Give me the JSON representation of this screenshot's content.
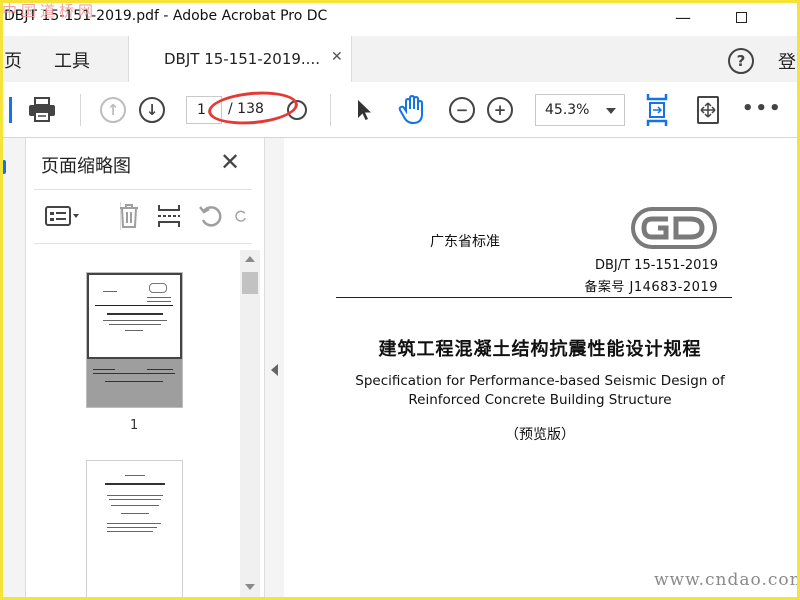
{
  "window": {
    "title": "DBJT 15-151-2019.pdf - Adobe Acrobat Pro DC",
    "watermark_top": "中国道桥网",
    "min_symbol": "—"
  },
  "tabs": {
    "home": "页",
    "tools": "工具",
    "document_tab": "DBJT 15-151-2019....",
    "close_symbol": "✕",
    "help_symbol": "?",
    "login": "登"
  },
  "toolbar": {
    "current_page": "1",
    "total_pages": "/ 138",
    "zoom": "45.3%",
    "more": "•••",
    "annotation_color": "#e53935"
  },
  "thumbnails": {
    "panel_title": "页面缩略图",
    "close_symbol": "✕",
    "pages": [
      {
        "number": "1"
      }
    ]
  },
  "document": {
    "std_type": "广东省标准",
    "std_code": "DBJ/T 15-151-2019",
    "record_no": "备案号 J14683-2019",
    "title_cn": "建筑工程混凝土结构抗震性能设计规程",
    "title_en_line1": "Specification for Performance-based Seismic Design of",
    "title_en_line2": "Reinforced Concrete Building Structure",
    "edition": "（预览版）"
  },
  "watermark_bottom": "www.cndao.com",
  "colors": {
    "border": "#f6e33a",
    "accent_blue": "#1473e6",
    "tabbar_bg": "#f2f2f2"
  }
}
